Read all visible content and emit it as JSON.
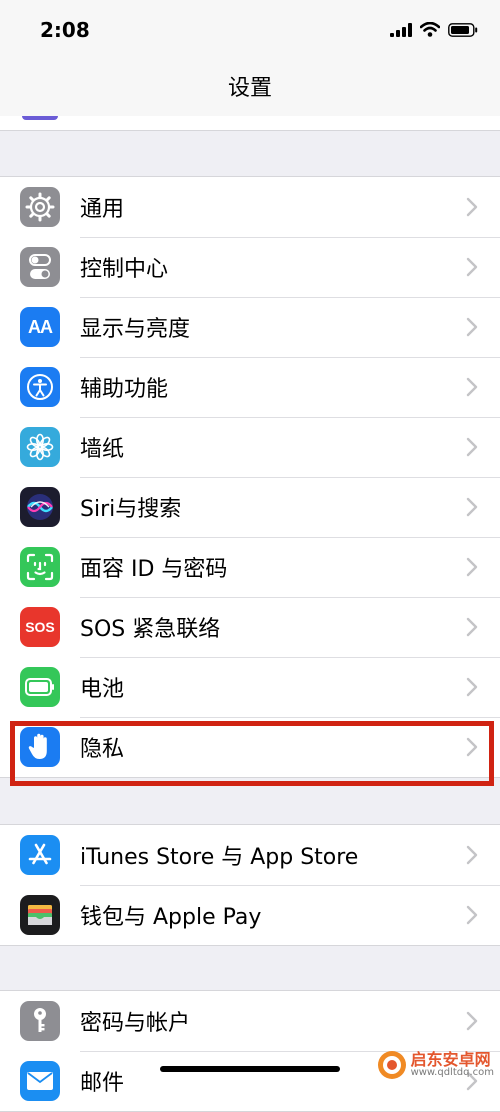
{
  "status_bar": {
    "time": "2:08"
  },
  "nav": {
    "title": "设置"
  },
  "groups": [
    {
      "items": [
        {
          "label": "通用",
          "icon": "gear-icon",
          "color": "#8e8e93"
        },
        {
          "label": "控制中心",
          "icon": "toggles-icon",
          "color": "#8e8e93"
        },
        {
          "label": "显示与亮度",
          "icon": "text-size-icon",
          "color": "#1b7cf2",
          "glyph": "AA"
        },
        {
          "label": "辅助功能",
          "icon": "accessibility-icon",
          "color": "#1b7cf2"
        },
        {
          "label": "墙纸",
          "icon": "flower-icon",
          "color": "#35aadc"
        },
        {
          "label": "Siri与搜索",
          "icon": "siri-icon",
          "color": "#1c1c2e"
        },
        {
          "label": "面容 ID 与密码",
          "icon": "face-id-icon",
          "color": "#34c759"
        },
        {
          "label": "SOS 紧急联络",
          "icon": "sos-icon",
          "color": "#e8362c",
          "glyph": "SOS"
        },
        {
          "label": "电池",
          "icon": "battery-icon",
          "color": "#34c759"
        },
        {
          "label": "隐私",
          "icon": "hand-icon",
          "color": "#1b7cf2"
        }
      ]
    },
    {
      "items": [
        {
          "label": "iTunes Store 与 App Store",
          "icon": "app-store-icon",
          "color": "#1b8ef2"
        },
        {
          "label": "钱包与 Apple Pay",
          "icon": "wallet-icon",
          "color": "#1c1c1e"
        }
      ]
    },
    {
      "items": [
        {
          "label": "密码与帐户",
          "icon": "key-icon",
          "color": "#8e8e93"
        },
        {
          "label": "邮件",
          "icon": "mail-icon",
          "color": "#1b8ef2"
        }
      ]
    }
  ],
  "highlight": {
    "color": "#d02312",
    "target": "隐私"
  },
  "watermark": {
    "name": "启东安卓网",
    "url": "www.qdltdq.com"
  }
}
